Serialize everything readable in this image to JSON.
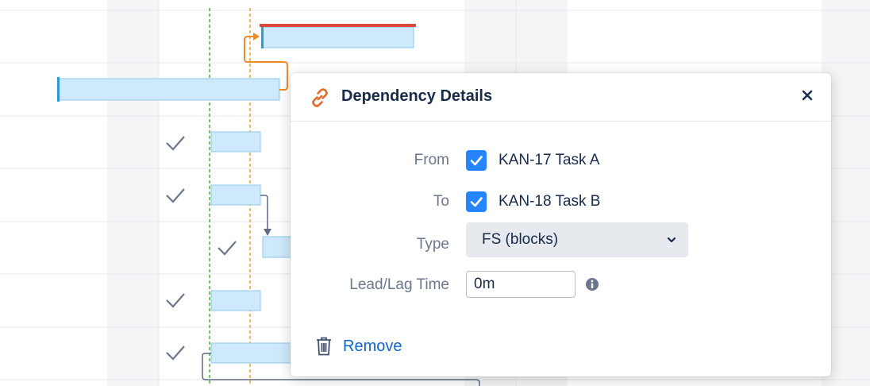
{
  "dialog": {
    "title": "Dependency Details",
    "icon": "link-icon",
    "close_icon": "close-icon",
    "from_label": "From",
    "from_value": "KAN-17 Task A",
    "from_checked": true,
    "to_label": "To",
    "to_value": "KAN-18 Task B",
    "to_checked": true,
    "type_label": "Type",
    "type_value": "FS (blocks)",
    "lead_lag_label": "Lead/Lag Time",
    "lead_lag_value": "0m",
    "info_icon": "info-icon",
    "remove_icon": "trash-icon",
    "remove_label": "Remove"
  },
  "colors": {
    "accent": "#2684ff",
    "link_icon": "#e8672a",
    "bar_fill": "#cde9fb",
    "bar_border": "#8fc7ea",
    "critical_line": "#d9483b",
    "today_line": "#52b043",
    "marker_line": "#f0a030",
    "dependency_arrow": "#f08a24"
  }
}
